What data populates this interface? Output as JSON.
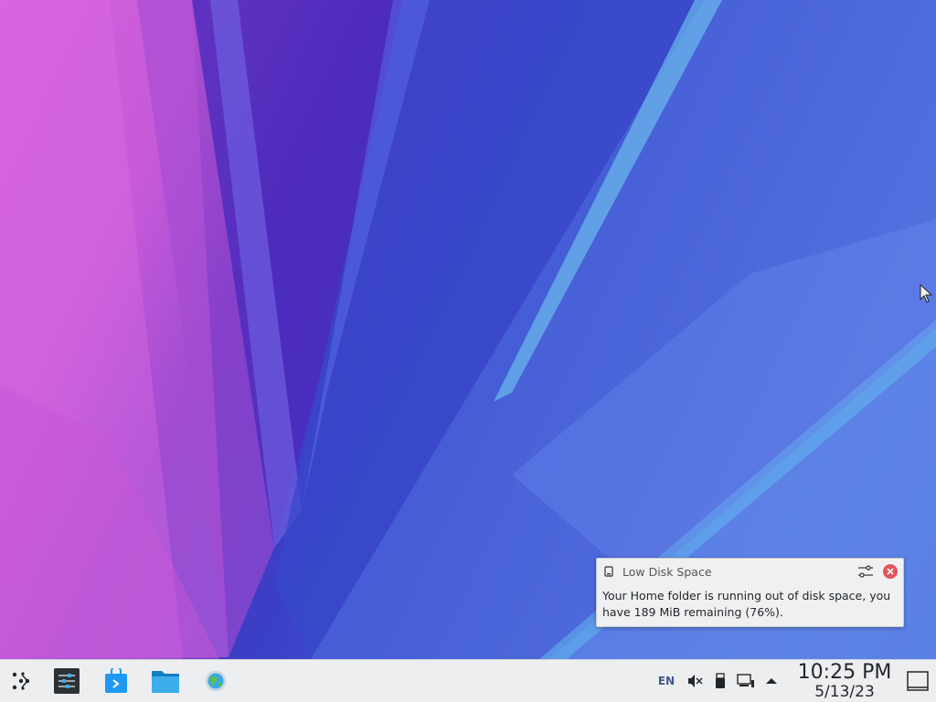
{
  "notification": {
    "title": "Low Disk Space",
    "body": "Your Home folder is running out of disk space, you have 189 MiB remaining (76%)."
  },
  "taskbar": {
    "launchers": [
      {
        "icon": "application-launcher-icon"
      },
      {
        "icon": "system-settings-icon"
      },
      {
        "icon": "discover-store-icon"
      },
      {
        "icon": "file-manager-icon"
      },
      {
        "icon": "web-browser-icon"
      }
    ],
    "tray": {
      "language": "EN"
    },
    "clock": {
      "time": "10:25 PM",
      "date": "5/13/23"
    }
  },
  "colors": {
    "taskbar_bg": "#edeef0",
    "close_red": "#e2545b",
    "accent_blue": "#3daee9"
  }
}
